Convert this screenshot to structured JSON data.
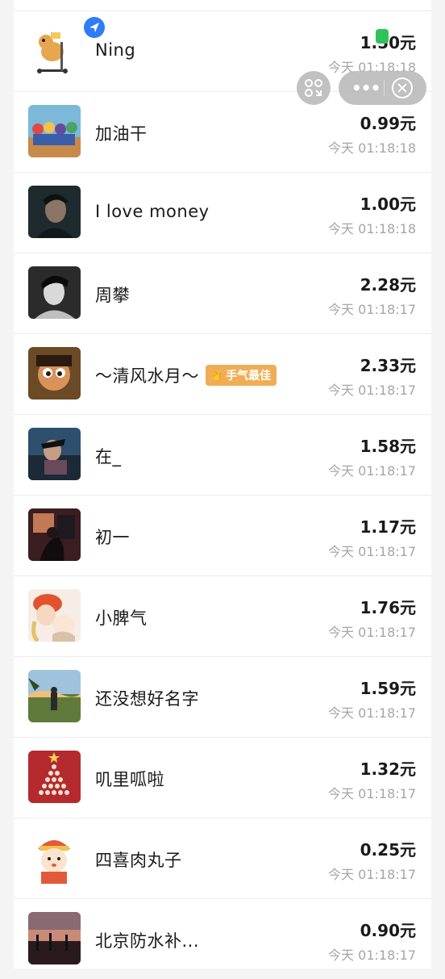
{
  "capsule": {
    "more_icon": "ellipsis-icon",
    "close_icon": "close-circle-icon",
    "scan_icon": "scan-icon"
  },
  "best_badge": {
    "label": "手气最佳",
    "color": "#f0ad55"
  },
  "records": [
    {
      "name": "Ning",
      "amount": "1.50元",
      "time": "今天 01:18:18"
    },
    {
      "name": "加油干",
      "amount": "0.99元",
      "time": "今天 01:18:18"
    },
    {
      "name": "I love money",
      "amount": "1.00元",
      "time": "今天 01:18:18"
    },
    {
      "name": "周攀",
      "amount": "2.28元",
      "time": "今天 01:18:17"
    },
    {
      "name": "～清风水月～",
      "amount": "2.33元",
      "time": "今天 01:18:17"
    },
    {
      "name": "在_",
      "amount": "1.58元",
      "time": "今天 01:18:17"
    },
    {
      "name": "初一",
      "amount": "1.17元",
      "time": "今天 01:18:17"
    },
    {
      "name": "小脾气",
      "amount": "1.76元",
      "time": "今天 01:18:17"
    },
    {
      "name": "还没想好名字",
      "amount": "1.59元",
      "time": "今天 01:18:17"
    },
    {
      "name": "叽里呱啦",
      "amount": "1.32元",
      "time": "今天 01:18:17"
    },
    {
      "name": "四喜肉丸子",
      "amount": "0.25元",
      "time": "今天 01:18:17"
    },
    {
      "name": "北京防水补...",
      "amount": "0.90元",
      "time": "今天 01:18:17"
    }
  ]
}
